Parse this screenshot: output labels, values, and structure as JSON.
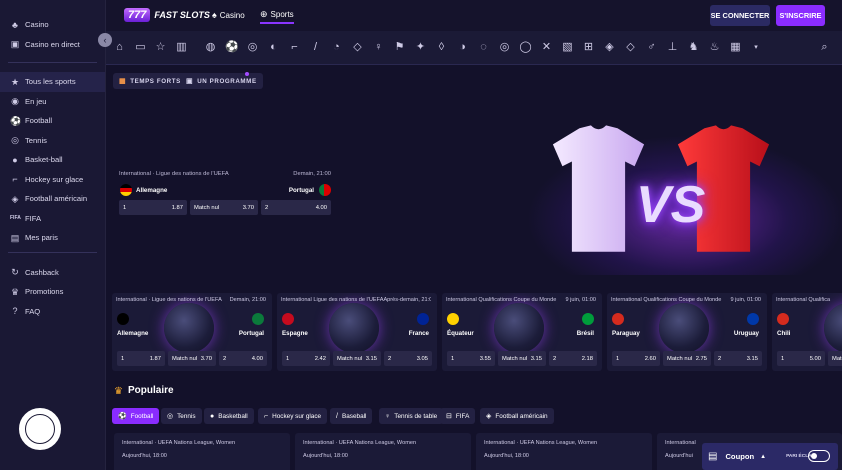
{
  "topbar": {
    "logo_num": "777",
    "logo_text": "FAST SLOTS",
    "nav_casino": "Casino",
    "nav_sports": "Sports",
    "login": "SE CONNECTER",
    "register": "S'INSCRIRE"
  },
  "sidebar": {
    "group1": [
      {
        "label": "Casino",
        "icon": "casino-icon"
      },
      {
        "label": "Casino en direct",
        "icon": "live-casino-icon"
      }
    ],
    "group2": [
      {
        "label": "Tous les sports",
        "icon": "star-icon"
      },
      {
        "label": "En jeu",
        "icon": "live-icon"
      },
      {
        "label": "Football",
        "icon": "football-icon"
      },
      {
        "label": "Tennis",
        "icon": "tennis-icon"
      },
      {
        "label": "Basket-ball",
        "icon": "basketball-icon"
      },
      {
        "label": "Hockey sur glace",
        "icon": "hockey-icon"
      },
      {
        "label": "Football américain",
        "icon": "american-football-icon"
      },
      {
        "label": "FIFA",
        "icon": "fifa-icon"
      },
      {
        "label": "Mes paris",
        "icon": "bets-icon"
      }
    ],
    "group3": [
      {
        "label": "Cashback",
        "icon": "cashback-icon"
      },
      {
        "label": "Promotions",
        "icon": "promotions-icon"
      },
      {
        "label": "FAQ",
        "icon": "faq-icon"
      }
    ]
  },
  "chips": {
    "top": "TEMPS FORTS",
    "program": "UN PROGRAMME"
  },
  "hero_match": {
    "league": "International · Ligue des nations de l'UEFA",
    "time": "Demain, 21:00",
    "home": "Allemagne",
    "away": "Portugal",
    "odds": [
      {
        "k": "1",
        "v": "1.87"
      },
      {
        "k": "Match nul",
        "v": "3.70"
      },
      {
        "k": "2",
        "v": "4.00"
      }
    ]
  },
  "cards": [
    {
      "league": "International · Ligue des nations de l'UEFA",
      "time": "Demain, 21:00",
      "home": "Allemagne",
      "away": "Portugal",
      "odds": [
        "1",
        "1.87",
        "Match nul",
        "3.70",
        "2",
        "4.00"
      ],
      "home_color": "#000000",
      "away_color": "#0b7a3b"
    },
    {
      "league": "International Ligue des nations de l'UEFA",
      "time": "Après-demain, 21:00",
      "home": "Espagne",
      "away": "France",
      "odds": [
        "1",
        "2.42",
        "Match nul",
        "3.15",
        "2",
        "3.05"
      ],
      "home_color": "#c60b1e",
      "away_color": "#002395"
    },
    {
      "league": "International Qualifications Coupe du Monde",
      "time": "9 juin, 01:00",
      "home": "Équateur",
      "away": "Brésil",
      "odds": [
        "1",
        "3.55",
        "Match nul",
        "3.15",
        "2",
        "2.18"
      ],
      "home_color": "#ffd100",
      "away_color": "#009c3b"
    },
    {
      "league": "International Qualifications Coupe du Monde",
      "time": "9 juin, 01:00",
      "home": "Paraguay",
      "away": "Uruguay",
      "odds": [
        "1",
        "2.60",
        "Match nul",
        "2.75",
        "2",
        "3.15"
      ],
      "home_color": "#d52b1e",
      "away_color": "#0038a8"
    },
    {
      "league": "International Qualifica",
      "time": "",
      "home": "Chili",
      "away": "",
      "odds": [
        "1",
        "5.00",
        "Match",
        "",
        "",
        ""
      ],
      "home_color": "#d52b1e",
      "away_color": "#0039a6"
    }
  ],
  "popular": {
    "title": "Populaire",
    "tabs": [
      "Football",
      "Tennis",
      "Basketball",
      "Hockey sur glace",
      "Baseball",
      "Tennis de table",
      "FIFA",
      "Football américain"
    ],
    "rows": [
      {
        "league": "International · UEFA Nations League, Women",
        "time": "Aujourd'hui, 18:00"
      },
      {
        "league": "International · UEFA Nations League, Women",
        "time": "Aujourd'hui, 18:00"
      },
      {
        "league": "International · UEFA Nations League, Women",
        "time": "Aujourd'hui, 18:00"
      },
      {
        "league": "International",
        "time": "Aujourd'hui"
      }
    ]
  },
  "coupon": {
    "label": "Coupon",
    "mode": "PARI ÉCLAIR"
  }
}
